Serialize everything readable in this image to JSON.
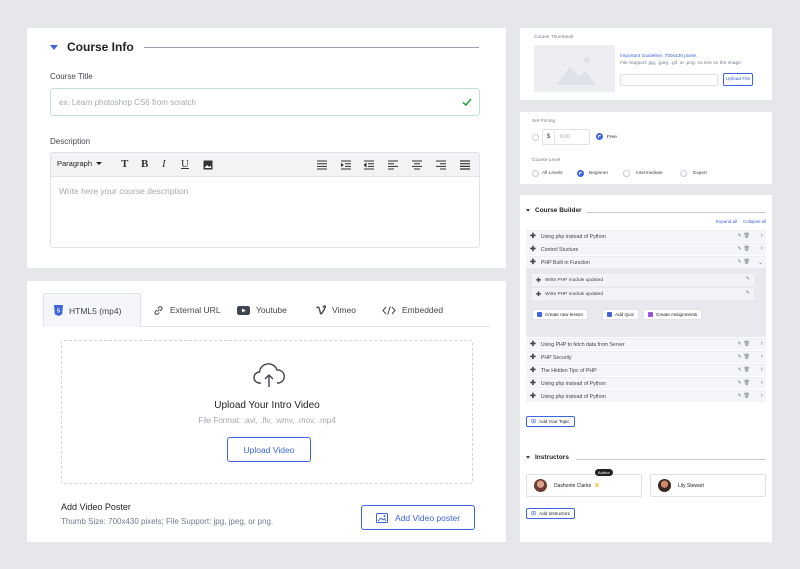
{
  "course_info": {
    "section_title": "Course Info",
    "course_title_label": "Course Title",
    "course_title_placeholder": "ex. Learn photoshop CS6 from scratch",
    "description_label": "Description",
    "paragraph_select": "Paragraph",
    "toolbar": [
      "T",
      "B",
      "I",
      "U"
    ],
    "description_placeholder": "Write here your course description"
  },
  "video": {
    "tabs": [
      {
        "label": "HTML5 (mp4)",
        "icon": "html5-icon",
        "active": true
      },
      {
        "label": "External URL",
        "icon": "link-icon",
        "active": false
      },
      {
        "label": "Youtube",
        "icon": "youtube-icon",
        "active": false
      },
      {
        "label": "Vimeo",
        "icon": "vimeo-icon",
        "active": false
      },
      {
        "label": "Embedded",
        "icon": "code-icon",
        "active": false
      }
    ],
    "upload_title": "Upload Your Intro Video",
    "upload_formats": "File Format: .avi, .flv, .wmv, .mov, .mp4",
    "upload_button": "Upload Video",
    "poster_title": "Add Video Poster",
    "poster_sub": "Thumb Size: 700x430 pixels; File Support: jpg, jpeg, or png.",
    "poster_button": "Add Video poster"
  },
  "thumbnail": {
    "label": "Course Thumbnail",
    "guideline": "Important Guideline: 700x430 pixels",
    "support": "File Support: jpg, .jpeg, .gif, or .png. no text on the image.",
    "upload_button": "Upload File"
  },
  "pricing": {
    "label": "Set Pricing",
    "currency": "$",
    "price_placeholder": "0.00",
    "free_label": "Free",
    "level_label": "Course Level",
    "levels": [
      {
        "label": "All Levels",
        "selected": false
      },
      {
        "label": "Beginner",
        "selected": true
      },
      {
        "label": "Intermediate",
        "selected": false
      },
      {
        "label": "Expert",
        "selected": false
      }
    ]
  },
  "builder": {
    "title": "Course Builder",
    "expand_all": "Expand all",
    "collapse_all": "Collapse all",
    "topics_top": [
      "Using php instead of Python",
      "Control Stucture",
      "PHP Built in Function"
    ],
    "lessons": [
      "Write PHP module updated",
      "Write PHP module updated"
    ],
    "actions": [
      "Create new lesson",
      "Add Quiz",
      "Create Assignments"
    ],
    "topics_bottom": [
      "Using PHP to fetch data from Server",
      "PHP Security",
      "The Hidden Tipc of PHP",
      "Using php instead of Python",
      "Using php instead of Python"
    ],
    "add_topic": "Add Your Topic",
    "accent": "#3e64de"
  },
  "instructors": {
    "title": "Instructors",
    "people": [
      {
        "name": "Dashonte Clarke",
        "badge": "Author"
      },
      {
        "name": "Lily Stewart",
        "badge": ""
      }
    ],
    "add_button": "Add Instructors"
  }
}
